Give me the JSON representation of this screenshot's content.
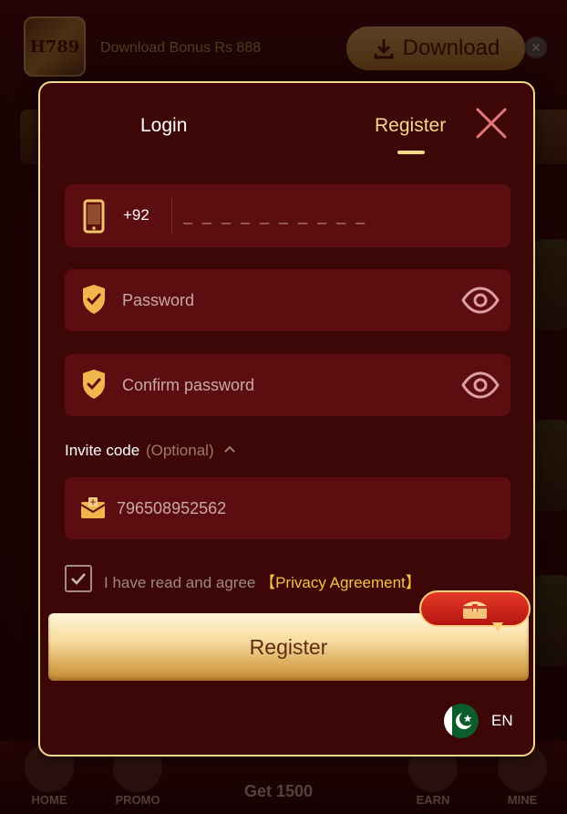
{
  "background": {
    "bonus_text": "Download Bonus Rs 888",
    "download_label": "Download",
    "bottom_nav": [
      "HOME",
      "PROMO",
      "Get 1500",
      "EARN",
      "MINE"
    ]
  },
  "modal": {
    "tabs": {
      "login": "Login",
      "register": "Register",
      "active": "register"
    },
    "phone": {
      "prefix": "+92",
      "placeholder": "_ _ _ _ _ _ _ _ _ _"
    },
    "password": {
      "placeholder": "Password"
    },
    "confirm_password": {
      "placeholder": "Confirm password"
    },
    "invite": {
      "label": "Invite code",
      "optional": "(Optional)",
      "value": "796508952562"
    },
    "agreement": {
      "checked": true,
      "text": "I have read and agree",
      "link": "【Privacy Agreement】"
    },
    "register_button": "Register",
    "language": {
      "label": "EN",
      "flag": "pakistan-flag"
    }
  },
  "colors": {
    "modal_bg": "#3d0708",
    "field_bg": "#5c0d10",
    "accent_gold": "#f6d88b",
    "link_gold": "#f6c244",
    "border_gold": "#f2d98a"
  }
}
